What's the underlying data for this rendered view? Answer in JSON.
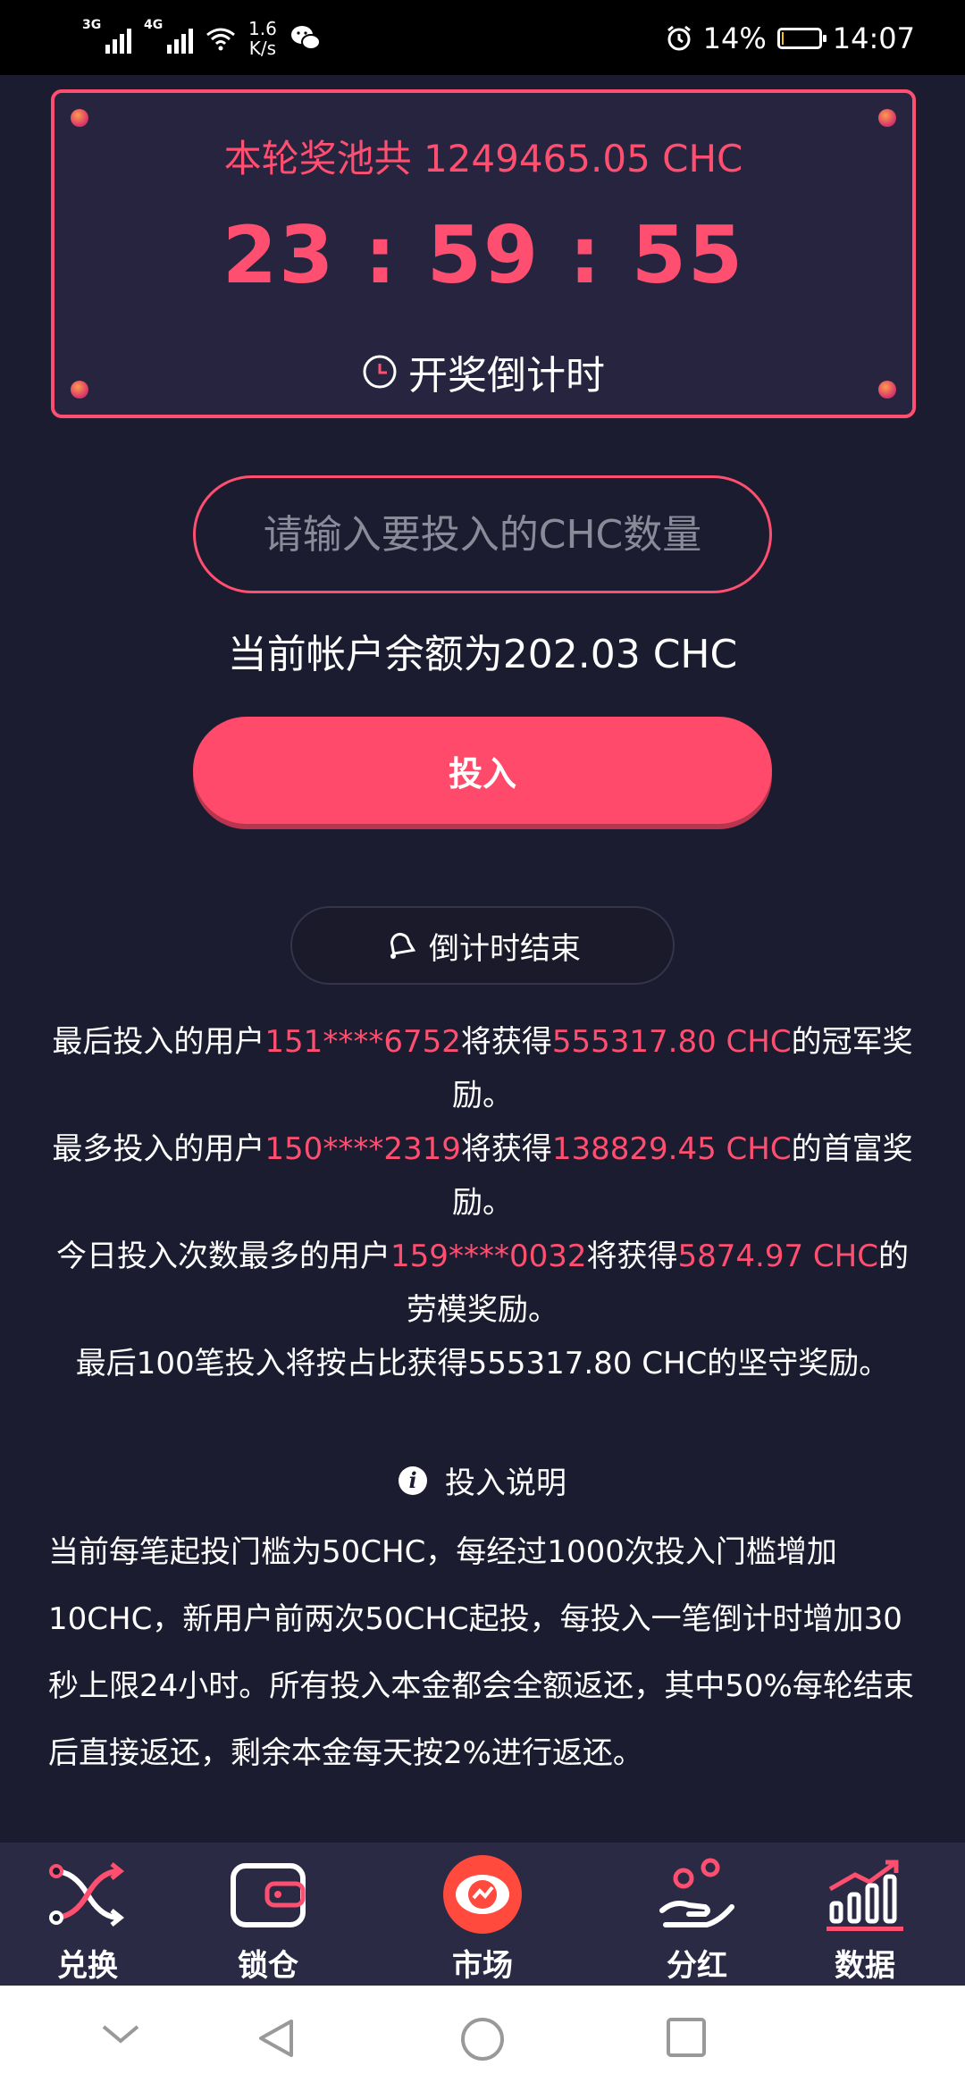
{
  "status_bar": {
    "network_1": "3G",
    "network_2": "4G",
    "speed_value": "1.6",
    "speed_unit": "K/s",
    "battery": "14%",
    "battery_level": 0.14,
    "time": "14:07"
  },
  "pool": {
    "title": "本轮奖池共 1249465.05 CHC",
    "countdown": "23 : 59 : 55",
    "countdown_label": "开奖倒计时"
  },
  "invest": {
    "placeholder": "请输入要投入的CHC数量",
    "balance_text": "当前帐户余额为202.03 CHC",
    "button_label": "投入"
  },
  "countdown_end": {
    "label": "倒计时结束"
  },
  "rewards": {
    "line1": {
      "prefix": "最后投入的用户",
      "user": "151****6752",
      "mid": "将获得",
      "amount": "555317.80 CHC",
      "suffix": "的冠军奖励。"
    },
    "line2": {
      "prefix": "最多投入的用户",
      "user": "150****2319",
      "mid": "将获得",
      "amount": "138829.45 CHC",
      "suffix": "的首富奖励。"
    },
    "line3": {
      "prefix": "今日投入次数最多的用户",
      "user": "159****0032",
      "mid": "将获得",
      "amount": "5874.97 CHC",
      "suffix": "的劳模奖励。"
    },
    "line4": "最后100笔投入将按占比获得555317.80 CHC的坚守奖励。"
  },
  "notes": {
    "title": "投入说明",
    "body": "当前每笔起投门槛为50CHC，每经过1000次投入门槛增加10CHC，新用户前两次50CHC起投，每投入一笔倒计时增加30秒上限24小时。所有投入本金都会全额返还，其中50%每轮结束后直接返还，剩余本金每天按2%进行返还。"
  },
  "bottom_nav": {
    "exchange": "兑换",
    "lock": "锁仓",
    "market": "市场",
    "dividend": "分红",
    "data": "数据"
  },
  "colors": {
    "accent": "#ff4f70",
    "background": "#1c1c30",
    "nav_background": "#2b2a44"
  }
}
